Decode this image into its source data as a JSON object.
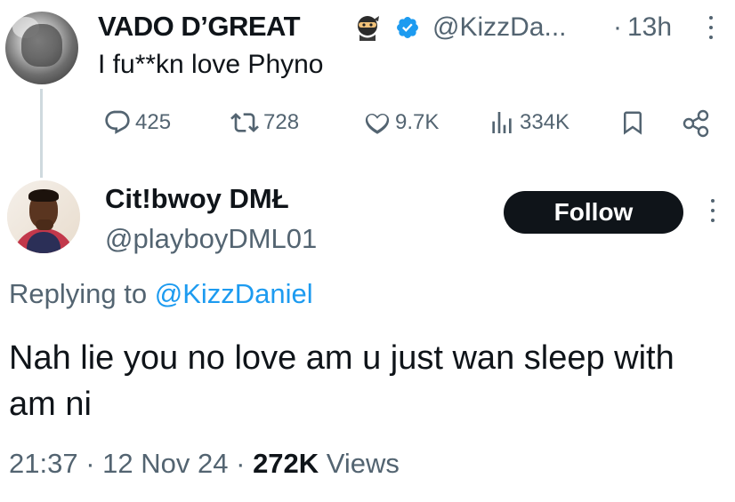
{
  "parent_tweet": {
    "display_name": "VADO D’GREAT",
    "name_emoji": "ninja-emoji",
    "verified": true,
    "handle": "@KizzDa...",
    "separator": "·",
    "time_ago": "13h",
    "text": "I fu**kn love Phyno",
    "stats": {
      "replies": "425",
      "retweets": "728",
      "likes": "9.7K",
      "views": "334K"
    }
  },
  "reply_tweet": {
    "display_name": "Cit!bwoy DMŁ",
    "handle": "@playboyDML01",
    "follow_label": "Follow",
    "replying_prefix": "Replying to",
    "replying_to": "@KizzDaniel",
    "text": "Nah lie you no love am u just wan sleep with am ni",
    "time": "21:37",
    "date": "12 Nov 24",
    "view_count": "272K",
    "views_label": "Views",
    "separator": "·"
  },
  "colors": {
    "text_primary": "#0f1419",
    "text_secondary": "#536471",
    "accent": "#1d9bf0",
    "thread_line": "#cfd9de",
    "follow_bg": "#0f1419"
  },
  "icons": [
    "reply-icon",
    "retweet-icon",
    "like-icon",
    "views-icon",
    "bookmark-icon",
    "share-icon",
    "verified-badge-icon",
    "more-icon"
  ]
}
